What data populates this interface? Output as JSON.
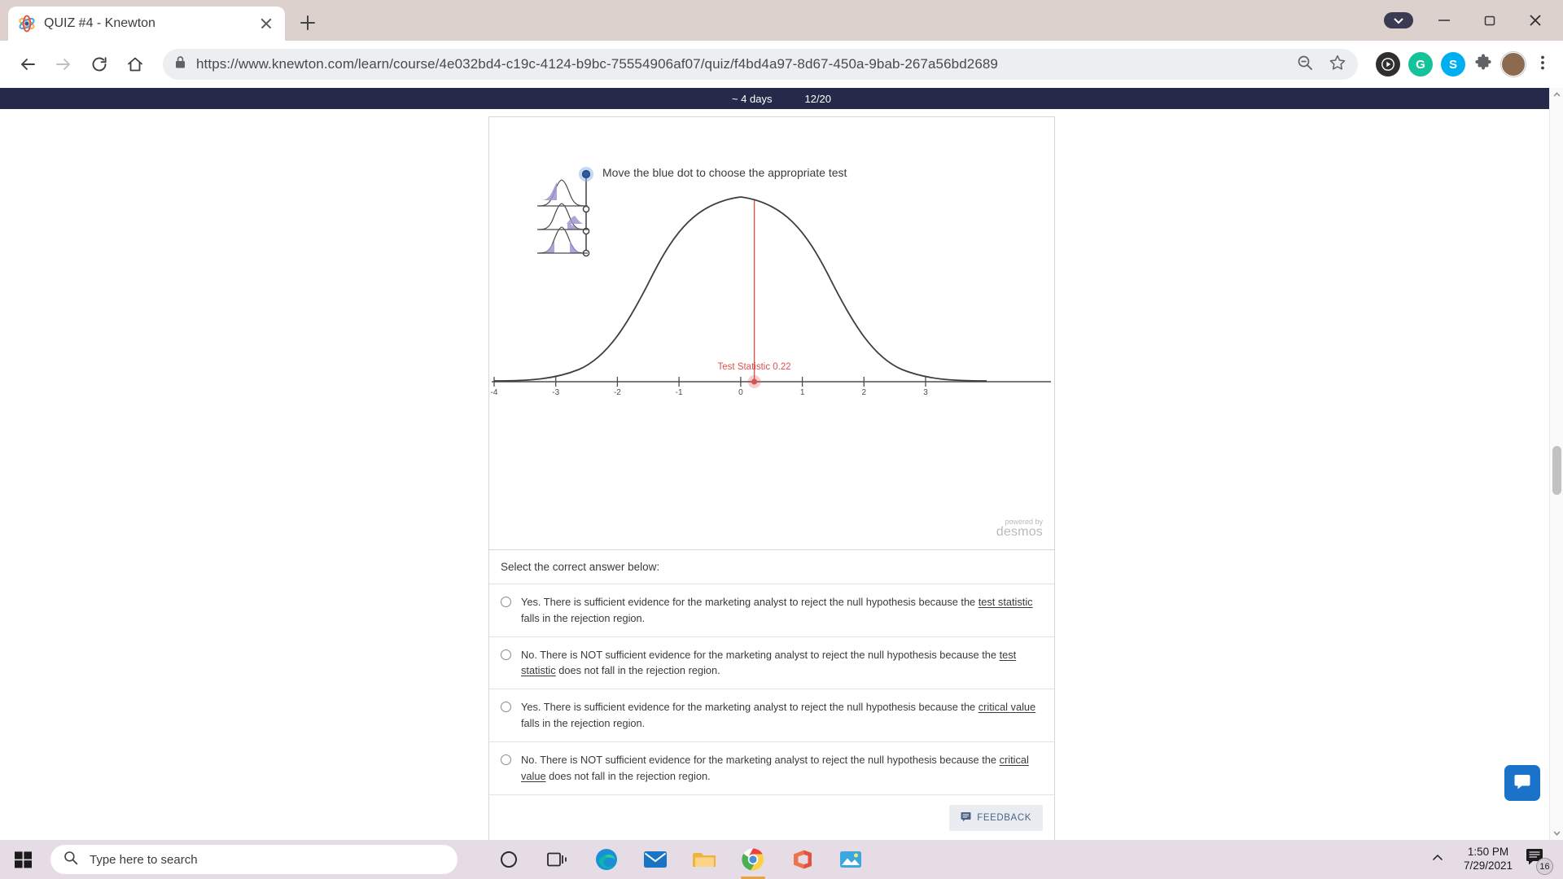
{
  "browser": {
    "tab": {
      "title": "QUIZ #4 - Knewton",
      "favicon_icon": "knewton-atom-icon",
      "close_icon": "close-icon"
    },
    "new_tab_icon": "plus-icon",
    "window_controls": {
      "minimize_icon": "minimize-icon",
      "maximize_icon": "maximize-icon",
      "close_icon": "window-close-icon",
      "profile_pill_icon": "chevron-down-pill-icon"
    },
    "nav": {
      "back_icon": "back-arrow-icon",
      "forward_icon": "forward-arrow-icon",
      "reload_icon": "reload-icon",
      "home_icon": "home-icon"
    },
    "omnibox": {
      "lock_icon": "lock-icon",
      "url": "https://www.knewton.com/learn/course/4e032bd4-c19c-4124-b9bc-75554906af07/quiz/f4bd4a97-8d67-450a-9bab-267a56bd2689",
      "zoom_icon": "zoom-out-icon",
      "bookmark_icon": "star-icon"
    },
    "extensions": [
      {
        "name": "media-play-extension-icon",
        "glyph": "▶",
        "color": "#2f2f2f"
      },
      {
        "name": "grammarly-extension-icon",
        "glyph": "G",
        "color": "#15c39a"
      },
      {
        "name": "skype-extension-icon",
        "glyph": "S",
        "color": "#00aff0"
      },
      {
        "name": "puzzle-extensions-icon",
        "glyph": "❖",
        "color": "#5f6368"
      },
      {
        "name": "profile-avatar",
        "glyph": "",
        "color": "#8b6a4f"
      },
      {
        "name": "chrome-menu-icon",
        "glyph": "⋮",
        "color": "#5f6368"
      }
    ]
  },
  "knewton_header": {
    "time_remaining": "~ 4 days",
    "progress": "12/20"
  },
  "graph": {
    "prompt": "Move the blue dot to choose the appropriate test",
    "watermark_line1": "powered by",
    "watermark_line2": "desmos",
    "test_statistic_label": "Test Statistic 0.22",
    "slider_icon": "distribution-selector-slider",
    "blue_dot_icon": "blue-draggable-dot",
    "thumbnails": [
      {
        "name": "left-tailed-distribution-thumbnail"
      },
      {
        "name": "right-tailed-distribution-thumbnail"
      },
      {
        "name": "two-tailed-distribution-thumbnail"
      }
    ]
  },
  "chart_data": {
    "type": "line",
    "title": "",
    "xlabel": "",
    "ylabel": "",
    "xlim": [
      -4.2,
      3.3
    ],
    "ylim": [
      0,
      0.42
    ],
    "grid": false,
    "legend": false,
    "xticks": [
      "-4",
      "-3",
      "-2",
      "-1",
      "0",
      "1",
      "2",
      "3"
    ],
    "xtick_values": [
      -4,
      -3,
      -2,
      -1,
      0,
      1,
      2,
      3
    ],
    "series": [
      {
        "name": "standard normal density",
        "curve": "normal",
        "mean": 0,
        "sd": 1,
        "color": "#3d3d3d"
      }
    ],
    "annotations": [
      {
        "name": "test-statistic-marker",
        "label": "Test Statistic 0.22",
        "x": 0.22,
        "color": "#d9534f",
        "type": "vertical-line-with-point"
      }
    ]
  },
  "answers": {
    "heading": "Select the correct answer below:",
    "options": [
      {
        "id": "option-a",
        "pre": "Yes. There is sufficient evidence for the marketing analyst to reject the null hypothesis because the ",
        "link": "test statistic",
        "post": " falls in the rejection region.",
        "selected": false
      },
      {
        "id": "option-b",
        "pre": "No. There is NOT sufficient evidence for the marketing analyst to reject the null hypothesis because the ",
        "link": "test statistic",
        "post": " does not fall in the rejection region.",
        "selected": false
      },
      {
        "id": "option-c",
        "pre": "Yes. There is sufficient evidence for the marketing analyst to reject the null hypothesis because the ",
        "link": "critical value",
        "post": " falls in the rejection region.",
        "selected": false
      },
      {
        "id": "option-d",
        "pre": "No. There is NOT sufficient evidence for the marketing analyst to reject the null hypothesis because the ",
        "link": "critical value",
        "post": " does not fall in the rejection region.",
        "selected": false
      }
    ],
    "feedback_button": "FEEDBACK",
    "feedback_icon": "feedback-message-icon"
  },
  "chat_widget": {
    "icon": "chat-bubble-icon"
  },
  "taskbar": {
    "start_icon": "windows-start-icon",
    "search_placeholder": "Type here to search",
    "search_icon": "search-icon",
    "items": [
      {
        "name": "cortana-icon",
        "glyph": "◯"
      },
      {
        "name": "task-view-icon",
        "glyph": ""
      },
      {
        "name": "microsoft-edge-icon",
        "glyph": ""
      },
      {
        "name": "mail-icon",
        "glyph": ""
      },
      {
        "name": "file-explorer-icon",
        "glyph": ""
      },
      {
        "name": "google-chrome-icon",
        "glyph": ""
      },
      {
        "name": "microsoft-office-icon",
        "glyph": ""
      },
      {
        "name": "photos-icon",
        "glyph": ""
      }
    ],
    "tray": {
      "show_hidden_icon": "chevron-up-icon",
      "time": "1:50 PM",
      "date": "7/29/2021",
      "notification_count": "16",
      "notification_icon": "notification-center-icon"
    }
  }
}
